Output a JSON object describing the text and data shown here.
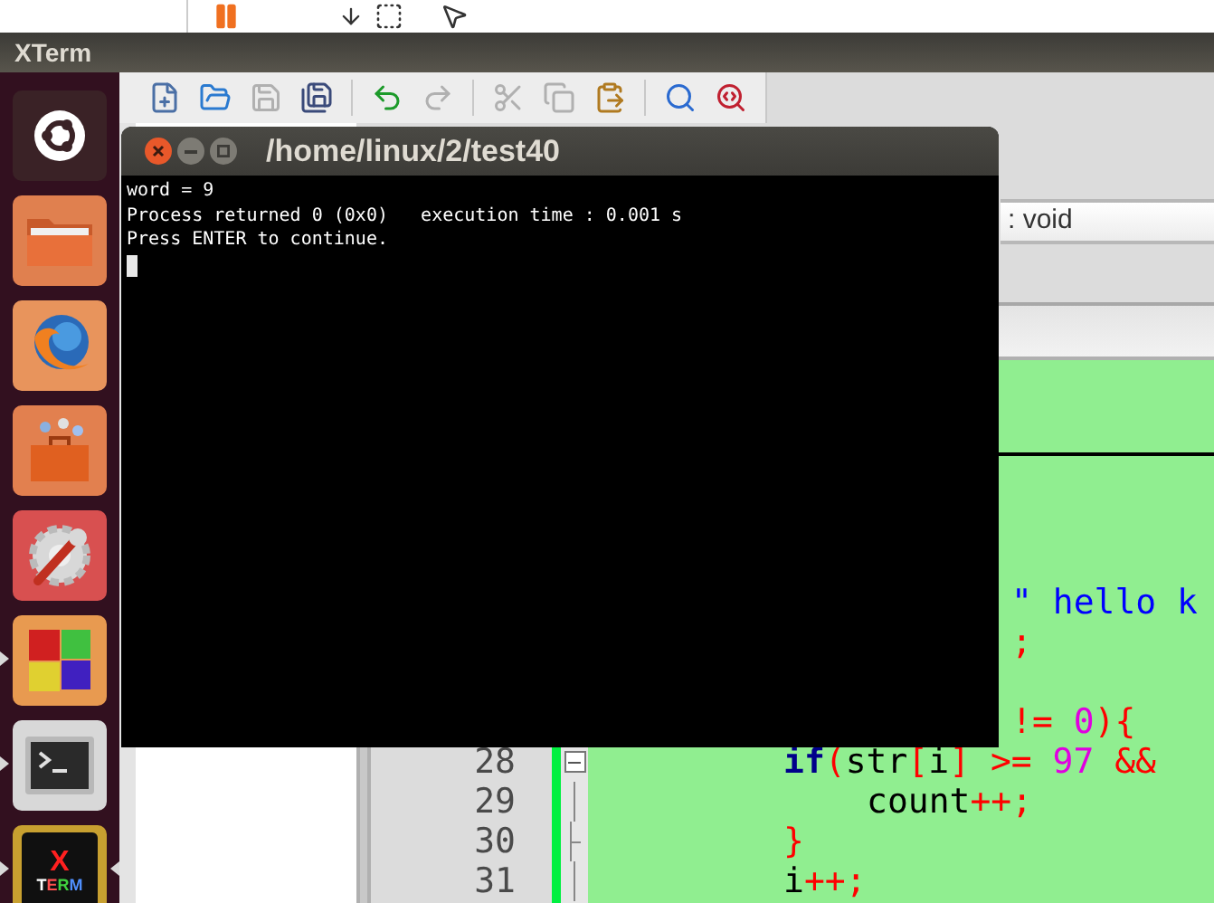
{
  "top_bar_title": {
    "title": "XTerm"
  },
  "launcher": {
    "items": [
      {
        "kind": "home",
        "running": false,
        "focused": false
      },
      {
        "kind": "files",
        "running": false,
        "focused": false
      },
      {
        "kind": "browser",
        "running": false,
        "focused": false
      },
      {
        "kind": "store",
        "running": false,
        "focused": false
      },
      {
        "kind": "settings",
        "running": false,
        "focused": false
      },
      {
        "kind": "cubes",
        "running": true,
        "focused": false
      },
      {
        "kind": "terminal",
        "running": true,
        "focused": false
      },
      {
        "kind": "xterm",
        "running": true,
        "focused": true,
        "logo_top": "X",
        "logo_bottom": "TERM"
      }
    ]
  },
  "toolbar": {
    "items": [
      {
        "kind": "new",
        "disabled": false,
        "separator_after": false
      },
      {
        "kind": "open",
        "disabled": false,
        "separator_after": false
      },
      {
        "kind": "save",
        "disabled": true,
        "separator_after": false
      },
      {
        "kind": "save_all",
        "disabled": false,
        "separator_after": true
      },
      {
        "kind": "undo",
        "disabled": false,
        "separator_after": false
      },
      {
        "kind": "redo",
        "disabled": true,
        "separator_after": true
      },
      {
        "kind": "cut",
        "disabled": true,
        "separator_after": false
      },
      {
        "kind": "copy",
        "disabled": true,
        "separator_after": false
      },
      {
        "kind": "paste",
        "disabled": false,
        "separator_after": true
      },
      {
        "kind": "find",
        "disabled": false,
        "separator_after": false
      },
      {
        "kind": "replace",
        "disabled": false,
        "separator_after": false
      }
    ]
  },
  "function_field": {
    "value": ": void"
  },
  "editor": {
    "lines": [
      {
        "kind": "tail",
        "gap_before": false,
        "segments": [
          {
            "kind": "string",
            "text": "\" hello k"
          }
        ]
      },
      {
        "kind": "tail",
        "gap_before": false,
        "segments": [
          {
            "kind": "op",
            "text": ";"
          }
        ]
      },
      {
        "kind": "tail",
        "gap_before": true,
        "segments": [
          {
            "kind": "op",
            "text": "!= "
          },
          {
            "kind": "number",
            "text": "0"
          },
          {
            "kind": "op",
            "text": "){"
          }
        ]
      },
      {
        "number": "28",
        "kind": "fold_start",
        "gap_before": false,
        "segments": [
          {
            "kind": "keyword",
            "text": "if"
          },
          {
            "kind": "op",
            "text": "("
          },
          {
            "kind": "plain",
            "text": "str"
          },
          {
            "kind": "op",
            "text": "["
          },
          {
            "kind": "plain",
            "text": "i"
          },
          {
            "kind": "op",
            "text": "] >= "
          },
          {
            "kind": "number",
            "text": "97"
          },
          {
            "kind": "op",
            "text": " &&"
          }
        ]
      },
      {
        "number": "29",
        "kind": "fold_inner_nested",
        "gap_before": false,
        "segments": [
          {
            "kind": "plain",
            "text": "count"
          },
          {
            "kind": "op",
            "text": "++;"
          }
        ]
      },
      {
        "number": "30",
        "kind": "fold_end",
        "gap_before": false,
        "segments": [
          {
            "kind": "op",
            "text": "}"
          }
        ]
      },
      {
        "number": "31",
        "kind": "fold_inner",
        "gap_before": false,
        "segments": [
          {
            "kind": "plain",
            "text": "i"
          },
          {
            "kind": "op",
            "text": "++;"
          }
        ]
      }
    ]
  },
  "xterm": {
    "title": "/home/linux/2/test40",
    "lines": [
      "word = 9",
      "Process returned 0 (0x0)   execution time : 0.001 s",
      "Press ENTER to continue."
    ]
  }
}
